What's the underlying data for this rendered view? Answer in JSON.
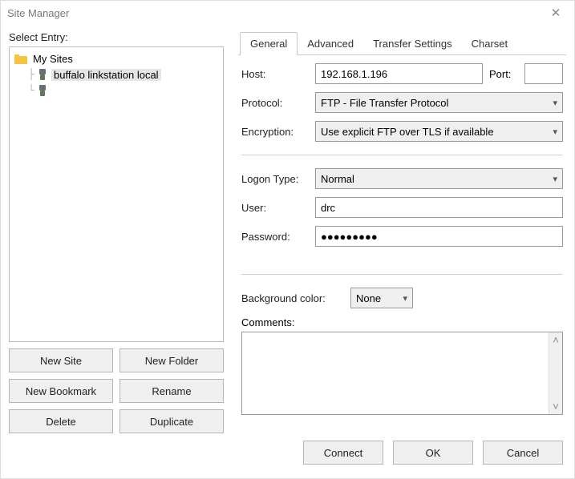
{
  "window": {
    "title": "Site Manager"
  },
  "left": {
    "select_label": "Select Entry:",
    "root_label": "My Sites",
    "items": [
      {
        "label": "buffalo linkstation local"
      },
      {
        "label": ""
      }
    ],
    "buttons": {
      "new_site": "New Site",
      "new_folder": "New Folder",
      "new_bookmark": "New Bookmark",
      "rename": "Rename",
      "delete": "Delete",
      "duplicate": "Duplicate"
    }
  },
  "tabs": {
    "general": "General",
    "advanced": "Advanced",
    "transfer": "Transfer Settings",
    "charset": "Charset"
  },
  "form": {
    "host_label": "Host:",
    "host_value": "192.168.1.196",
    "port_label": "Port:",
    "port_value": "",
    "protocol_label": "Protocol:",
    "protocol_value": "FTP - File Transfer Protocol",
    "encryption_label": "Encryption:",
    "encryption_value": "Use explicit FTP over TLS if available",
    "logon_label": "Logon Type:",
    "logon_value": "Normal",
    "user_label": "User:",
    "user_value": "drc",
    "password_label": "Password:",
    "password_value": "●●●●●●●●●",
    "bgcolor_label": "Background color:",
    "bgcolor_value": "None",
    "comments_label": "Comments:"
  },
  "footer": {
    "connect": "Connect",
    "ok": "OK",
    "cancel": "Cancel"
  }
}
